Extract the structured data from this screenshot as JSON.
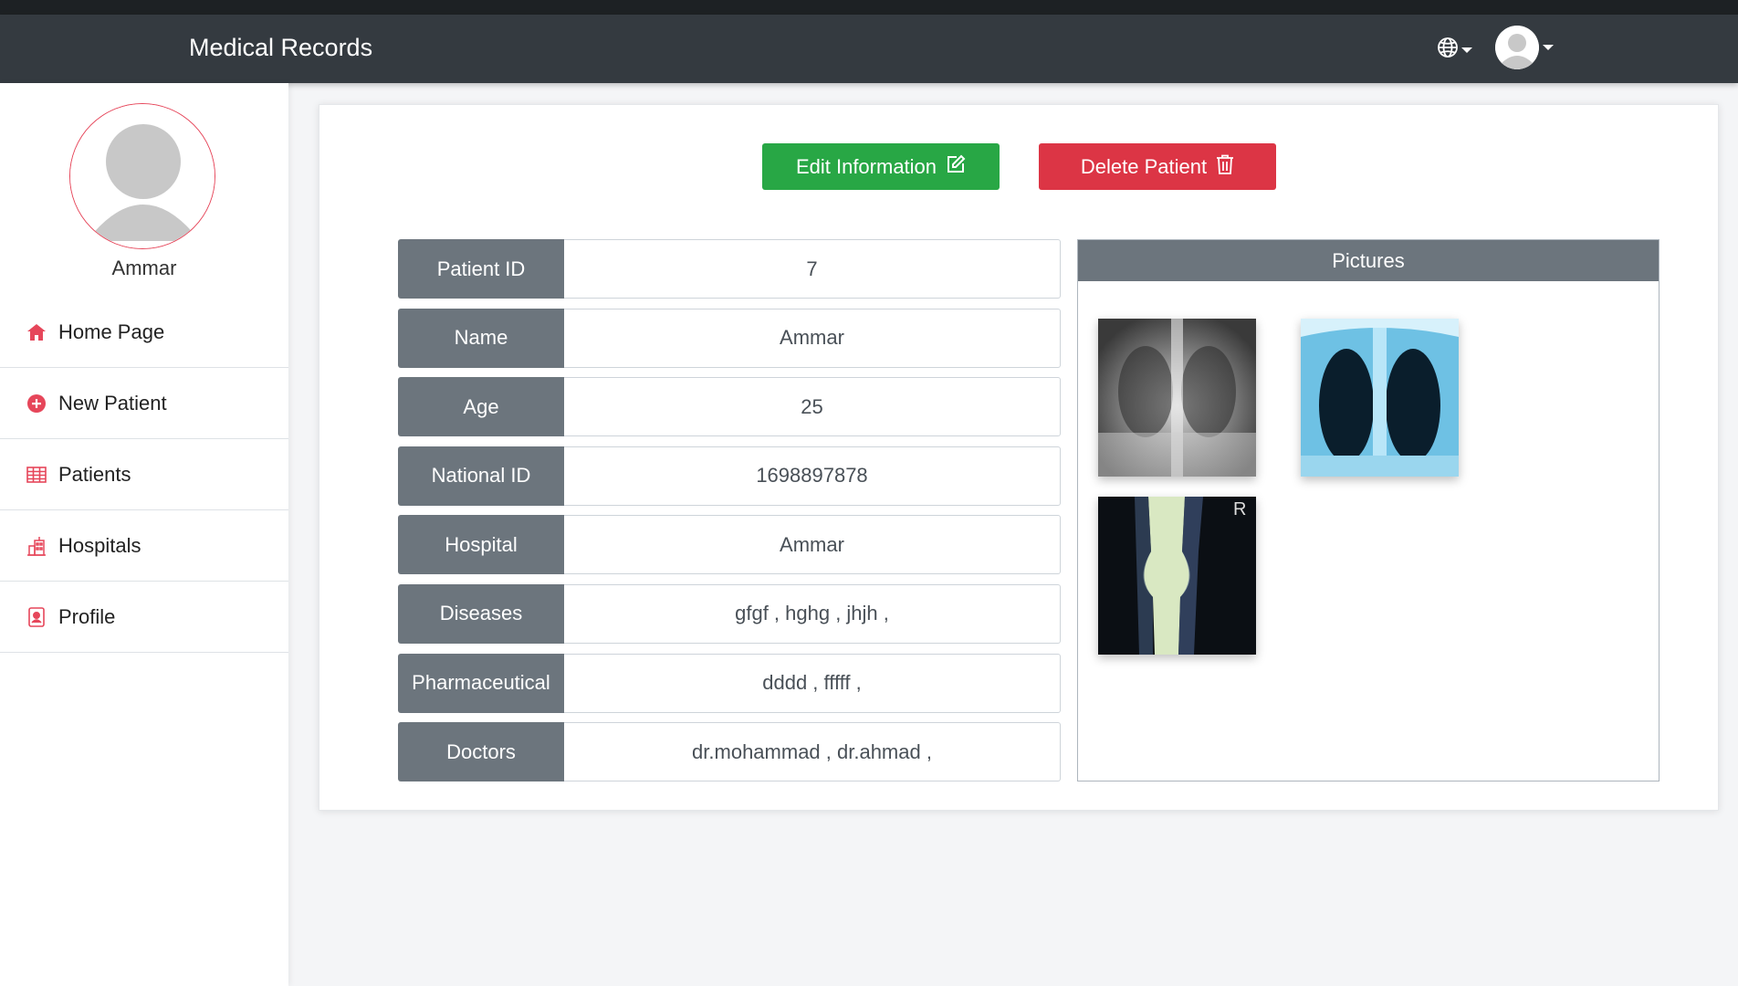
{
  "app": {
    "title": "Medical Records"
  },
  "navbar": {
    "language_icon": "globe-icon",
    "user_icon": "avatar"
  },
  "sidebar": {
    "user_name": "Ammar",
    "items": [
      {
        "label": "Home Page",
        "icon": "home-icon"
      },
      {
        "label": "New Patient",
        "icon": "plus-circle-icon"
      },
      {
        "label": "Patients",
        "icon": "table-icon"
      },
      {
        "label": "Hospitals",
        "icon": "hospital-icon"
      },
      {
        "label": "Profile",
        "icon": "profile-icon"
      }
    ]
  },
  "actions": {
    "edit_label": "Edit Information",
    "delete_label": "Delete Patient"
  },
  "patient": [
    {
      "label": "Patient ID",
      "value": "7"
    },
    {
      "label": "Name",
      "value": "Ammar"
    },
    {
      "label": "Age",
      "value": "25"
    },
    {
      "label": "National ID",
      "value": "1698897878"
    },
    {
      "label": "Hospital",
      "value": "Ammar"
    },
    {
      "label": "Diseases",
      "value": "gfgf , hghg , jhjh ,"
    },
    {
      "label": "Pharmaceutical",
      "value": "dddd , fffff ,"
    },
    {
      "label": "Doctors",
      "value": "dr.mohammad , dr.ahmad ,"
    }
  ],
  "pictures": {
    "title": "Pictures",
    "images": [
      "chest-xray-grayscale",
      "chest-xray-blue",
      "knee-xray"
    ]
  },
  "colors": {
    "navbar": "#343a40",
    "success": "#28a745",
    "danger": "#dc3545",
    "label_bg": "#6c757d",
    "accent": "#e6465a"
  }
}
